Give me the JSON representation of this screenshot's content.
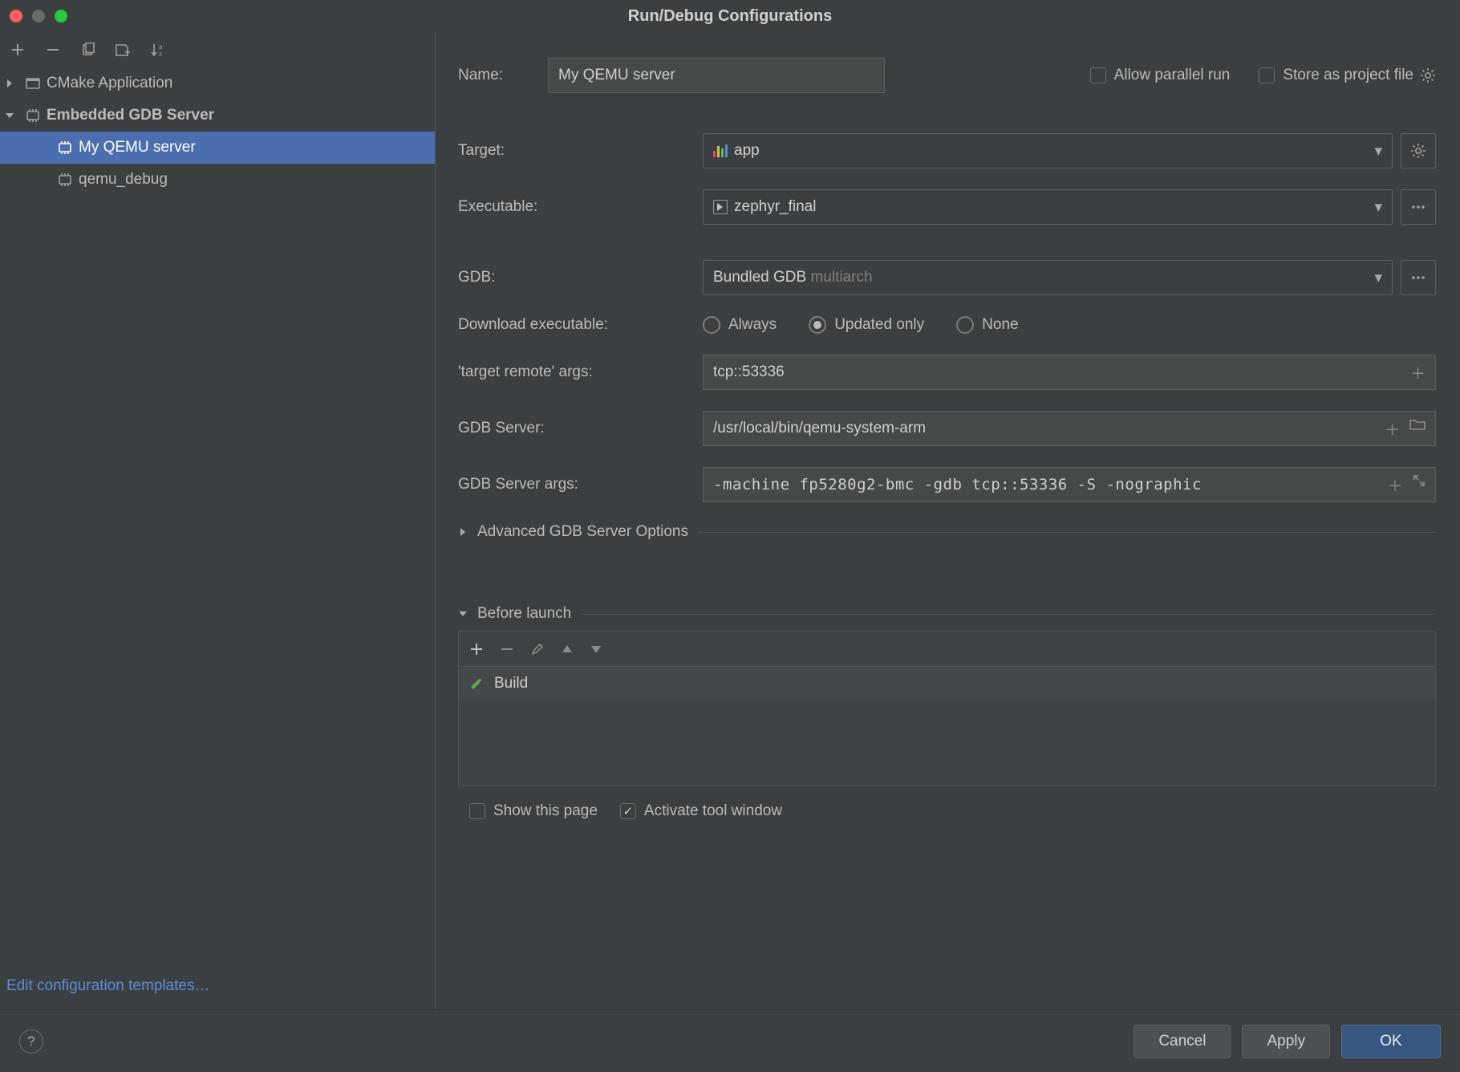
{
  "title": "Run/Debug Configurations",
  "traffic": {
    "red": true,
    "yellow_dim": true,
    "green": true
  },
  "sidebar": {
    "configs": {
      "cmake_app": "CMake Application",
      "gdb_server": "Embedded GDB Server",
      "item_my_qemu": "My QEMU server",
      "item_qemu_debug": "qemu_debug"
    },
    "edit_templates": "Edit configuration templates…"
  },
  "form": {
    "name_label": "Name:",
    "name_value": "My QEMU server",
    "allow_parallel": "Allow parallel run",
    "store_as_project": "Store as project file",
    "target_label": "Target:",
    "target_value": "app",
    "executable_label": "Executable:",
    "executable_value": "zephyr_final",
    "gdb_label": "GDB:",
    "gdb_value": "Bundled GDB",
    "gdb_suffix": "multiarch",
    "download_label": "Download executable:",
    "radios": {
      "always": "Always",
      "updated": "Updated only",
      "none": "None",
      "selected": "updated"
    },
    "target_remote_label": "'target remote' args:",
    "target_remote_value": "tcp::53336",
    "gdb_server_label": "GDB Server:",
    "gdb_server_value": "/usr/local/bin/qemu-system-arm",
    "gdb_server_args_label": "GDB Server args:",
    "gdb_server_args_value": " -machine fp5280g2-bmc -gdb tcp::53336 -S -nographic",
    "advanced_section": "Advanced GDB Server Options",
    "before_launch_section": "Before launch",
    "before_launch_item": "Build",
    "show_this_page": "Show this page",
    "activate_tool_window": "Activate tool window"
  },
  "footer": {
    "cancel": "Cancel",
    "apply": "Apply",
    "ok": "OK"
  }
}
